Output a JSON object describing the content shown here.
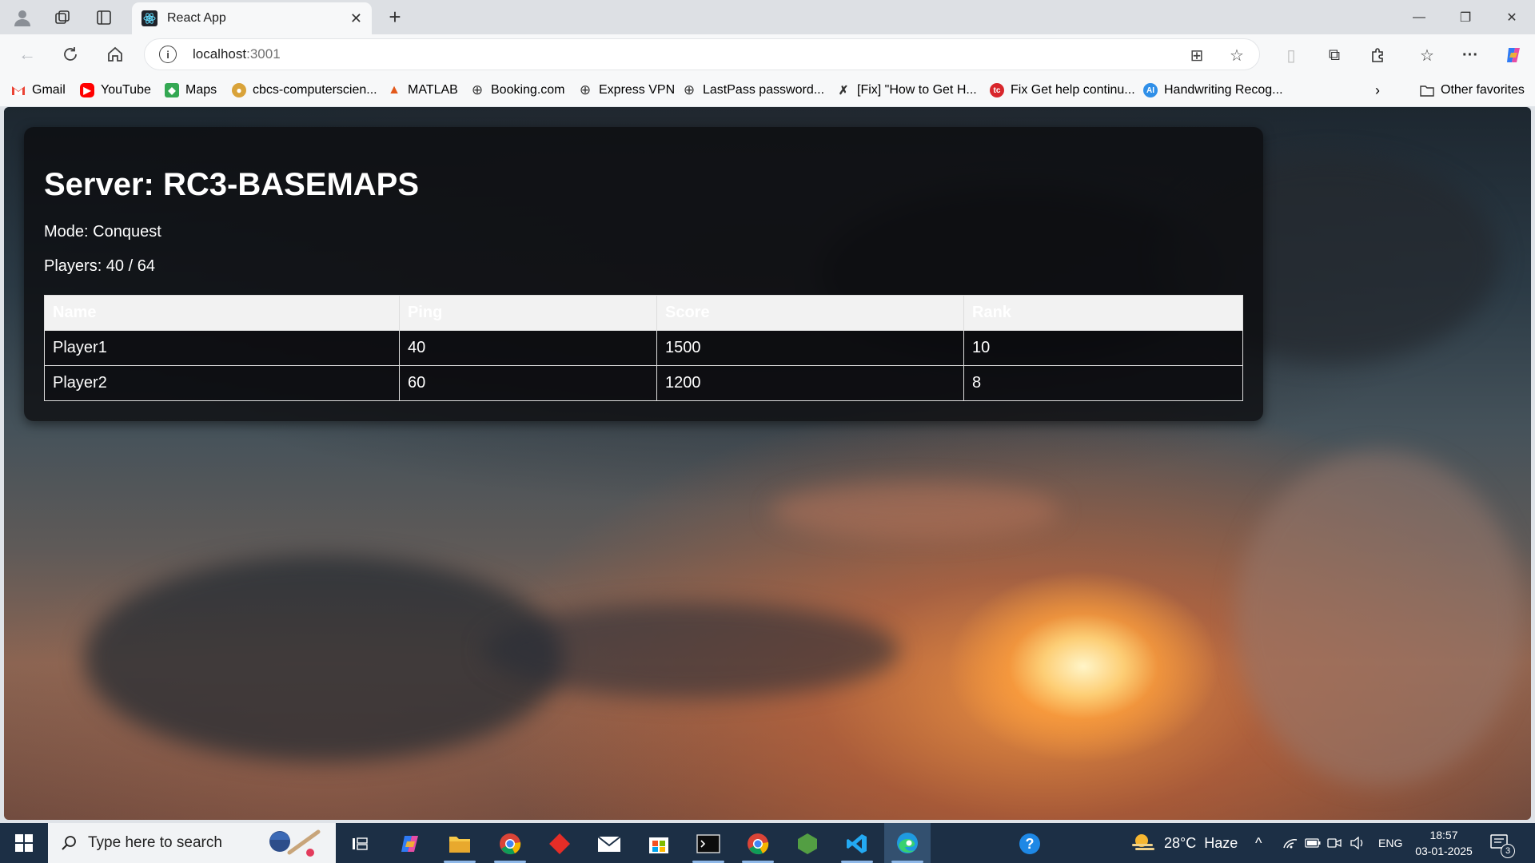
{
  "browser": {
    "tab_title": "React App",
    "url_host": "localhost",
    "url_port": ":3001",
    "bookmarks": [
      {
        "label": "Gmail",
        "icon": "gmail-icon"
      },
      {
        "label": "YouTube",
        "icon": "youtube-icon"
      },
      {
        "label": "Maps",
        "icon": "maps-icon"
      },
      {
        "label": "cbcs-computerscien...",
        "icon": "site-icon"
      },
      {
        "label": "MATLAB",
        "icon": "matlab-icon"
      },
      {
        "label": "Booking.com",
        "icon": "globe-icon"
      },
      {
        "label": "Express VPN",
        "icon": "globe-icon"
      },
      {
        "label": "LastPass password...",
        "icon": "globe-icon"
      },
      {
        "label": "[Fix] \"How to Get H...",
        "icon": "site-icon"
      },
      {
        "label": "Fix Get help continu...",
        "icon": "site-icon"
      },
      {
        "label": "Handwriting Recog...",
        "icon": "ai-icon"
      }
    ],
    "other_favorites": "Other favorites"
  },
  "page": {
    "title": "Server: RC3-BASEMAPS",
    "mode": "Mode: Conquest",
    "players": "Players: 40 / 64",
    "table": {
      "headers": [
        "Name",
        "Ping",
        "Score",
        "Rank"
      ],
      "rows": [
        [
          "Player1",
          "40",
          "1500",
          "10"
        ],
        [
          "Player2",
          "60",
          "1200",
          "8"
        ]
      ]
    }
  },
  "taskbar": {
    "search_placeholder": "Type here to search",
    "weather": "28°C  Haze",
    "language": "ENG",
    "time": "18:57",
    "date": "03-01-2025",
    "notifications": "3"
  }
}
